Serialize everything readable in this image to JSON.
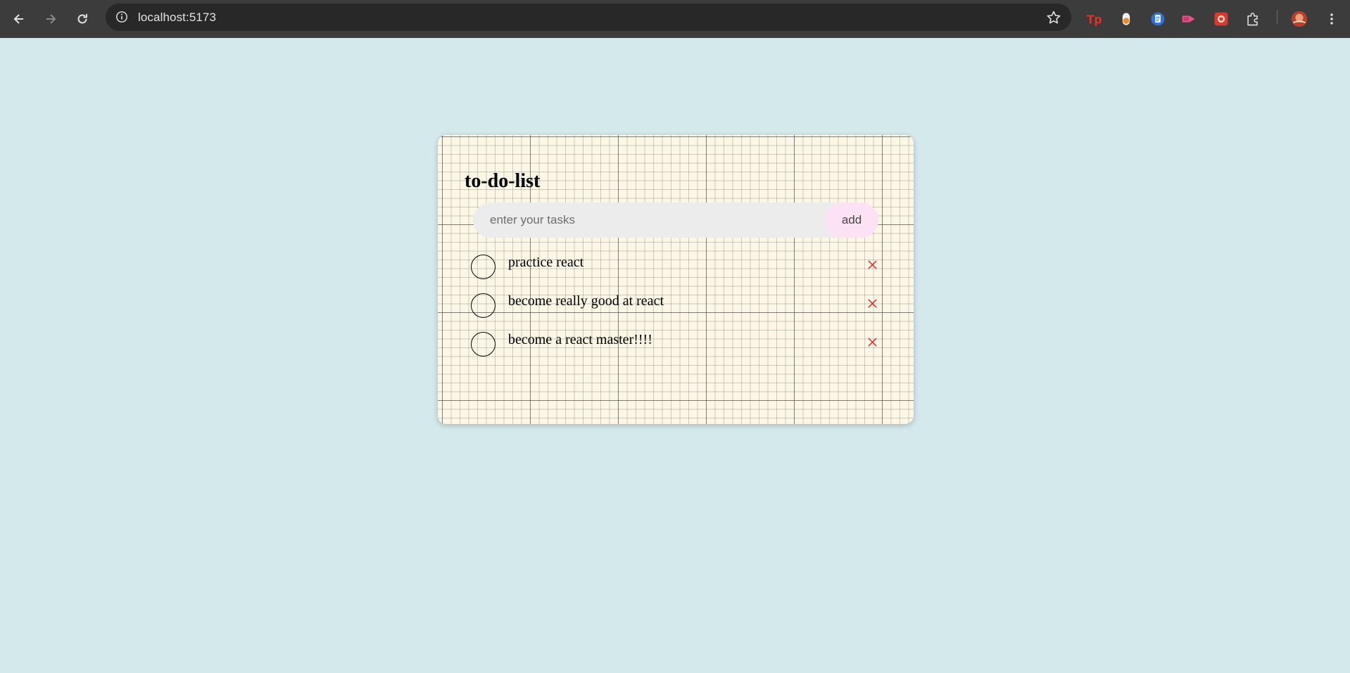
{
  "browser": {
    "url": "localhost:5173",
    "icons": {
      "back": "back-arrow-icon",
      "forward": "forward-arrow-icon",
      "reload": "reload-icon",
      "info": "site-info-icon",
      "bookmark": "bookmark-star-icon",
      "extensions": [
        "tp-extension-icon",
        "orange-dot-extension-icon",
        "document-extension-icon",
        "video-arrow-extension-icon",
        "red-box-extension-icon",
        "puzzle-extensions-icon"
      ],
      "profile": "profile-avatar-icon",
      "menu": "kebab-menu-icon"
    }
  },
  "app": {
    "title": "to-do-list",
    "input": {
      "placeholder": "enter your tasks",
      "value": ""
    },
    "add_label": "add",
    "tasks": [
      {
        "text": "practice react",
        "done": false
      },
      {
        "text": "become really good at react",
        "done": false
      },
      {
        "text": "become a react master!!!!",
        "done": false
      }
    ]
  },
  "colors": {
    "page_bg": "#d4e9ec",
    "card_bg": "#fbf6e6",
    "input_bg": "#ececec",
    "add_bg": "#fde2f6",
    "delete": "#e02020"
  }
}
